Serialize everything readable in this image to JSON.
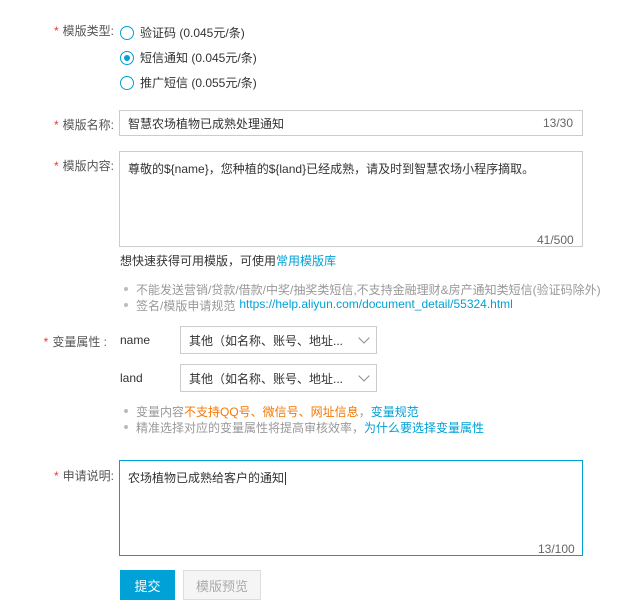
{
  "template_type": {
    "label": "模版类型:",
    "options": [
      {
        "label": "验证码 (0.045元/条)",
        "selected": false
      },
      {
        "label": "短信通知 (0.045元/条)",
        "selected": true
      },
      {
        "label": "推广短信 (0.055元/条)",
        "selected": false
      }
    ]
  },
  "template_name": {
    "label": "模版名称:",
    "value": "智慧农场植物已成熟处理通知",
    "counter": "13/30"
  },
  "template_content": {
    "label": "模版内容:",
    "value": "尊敬的${name}，您种植的${land}已经成熟，请及时到智慧农场小程序摘取。",
    "counter": "41/500",
    "quick_tip_prefix": "想快速获得可用模版，可使用",
    "quick_tip_link": "常用模版库",
    "hints": [
      "不能发送营销/贷款/借款/中奖/抽奖类短信,不支持金融理财&房产通知类短信(验证码除外)"
    ],
    "sign_hint_prefix": "签名/模版申请规范 ",
    "sign_hint_link": "https://help.aliyun.com/document_detail/55324.html"
  },
  "variables": {
    "label": "变量属性 :",
    "items": [
      {
        "name": "name",
        "value": "其他（如名称、账号、地址..."
      },
      {
        "name": "land",
        "value": "其他（如名称、账号、地址..."
      }
    ],
    "hint1_prefix": "变量内容",
    "hint1_warn": "不支持QQ号、微信号、网址信息",
    "hint1_sep": "，",
    "hint1_link": "变量规范",
    "hint2_prefix": "精准选择对应的变量属性将提高审核效率，",
    "hint2_link": "为什么要选择变量属性"
  },
  "application": {
    "label": "申请说明:",
    "value": "农场植物已成熟给客户的通知",
    "counter": "13/100"
  },
  "buttons": {
    "submit": "提交",
    "preview": "模版预览"
  },
  "colors": {
    "accent": "#00a1d6",
    "required": "#e4393c",
    "warning": "#f47800"
  }
}
